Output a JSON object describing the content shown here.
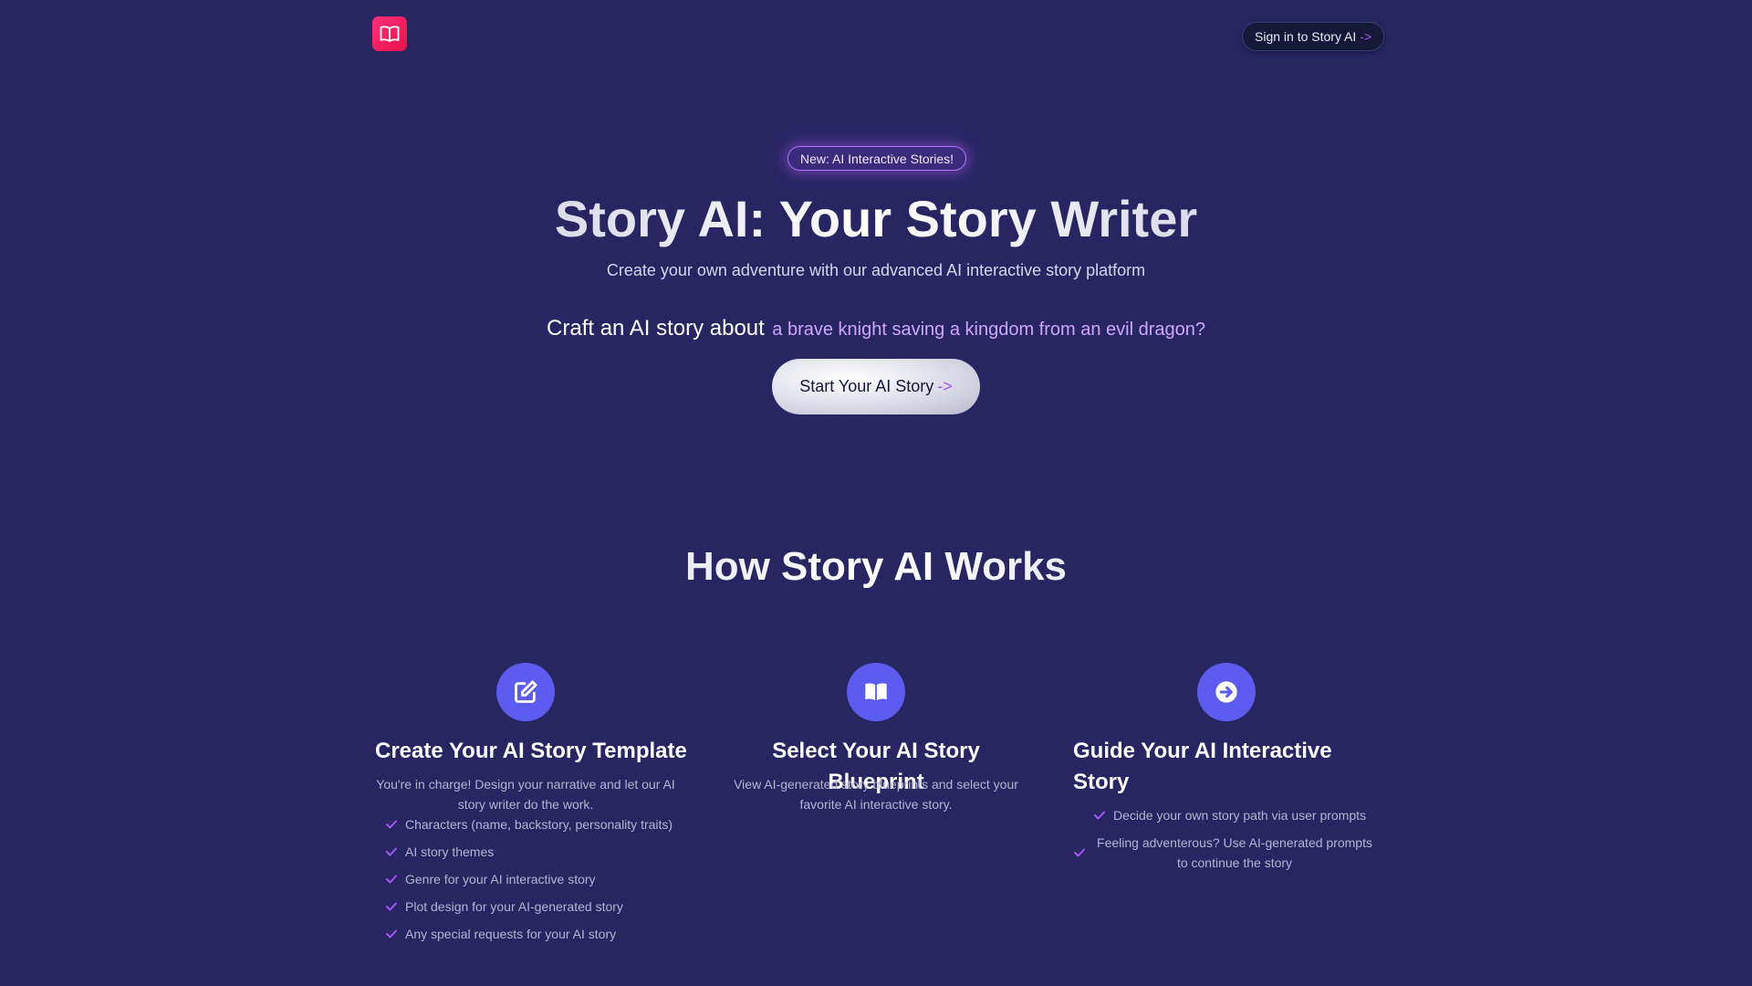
{
  "header": {
    "logo_icon": "open-book-icon",
    "signin_label": "Sign in to Story AI",
    "signin_arrow": "->"
  },
  "hero": {
    "badge": "New: AI Interactive Stories!",
    "title": "Story AI: Your Story Writer",
    "subtitle": "Create your own adventure with our advanced AI interactive story platform",
    "craft_lead": "Craft an AI story about",
    "craft_example": "a brave knight saving a kingdom from an evil dragon?",
    "cta_label": "Start Your AI Story",
    "cta_arrow": "->"
  },
  "how": {
    "title": "How Story AI Works",
    "steps": [
      {
        "icon": "edit-icon",
        "title": "Create Your AI Story Template",
        "description": "You're in charge! Design your narrative and let our AI story writer do the work.",
        "items": [
          "Characters (name, backstory, personality traits)",
          "AI story themes",
          "Genre for your AI interactive story",
          "Plot design for your AI-generated story",
          "Any special requests for your AI story"
        ]
      },
      {
        "icon": "book-icon",
        "title": "Select Your AI Story Blueprint",
        "description": "View AI-generated story blueprints and select your favorite AI interactive story."
      },
      {
        "icon": "arrow-circle-right-icon",
        "title": "Guide Your AI Interactive Story",
        "items": [
          "Decide your own story path via user prompts",
          "Feeling adventerous? Use AI-generated prompts to continue the story"
        ]
      }
    ]
  },
  "colors": {
    "background": "#272663",
    "accent": "#a855f7",
    "step_icon_bg": "#5d5cf0",
    "logo": "#f0185f"
  }
}
